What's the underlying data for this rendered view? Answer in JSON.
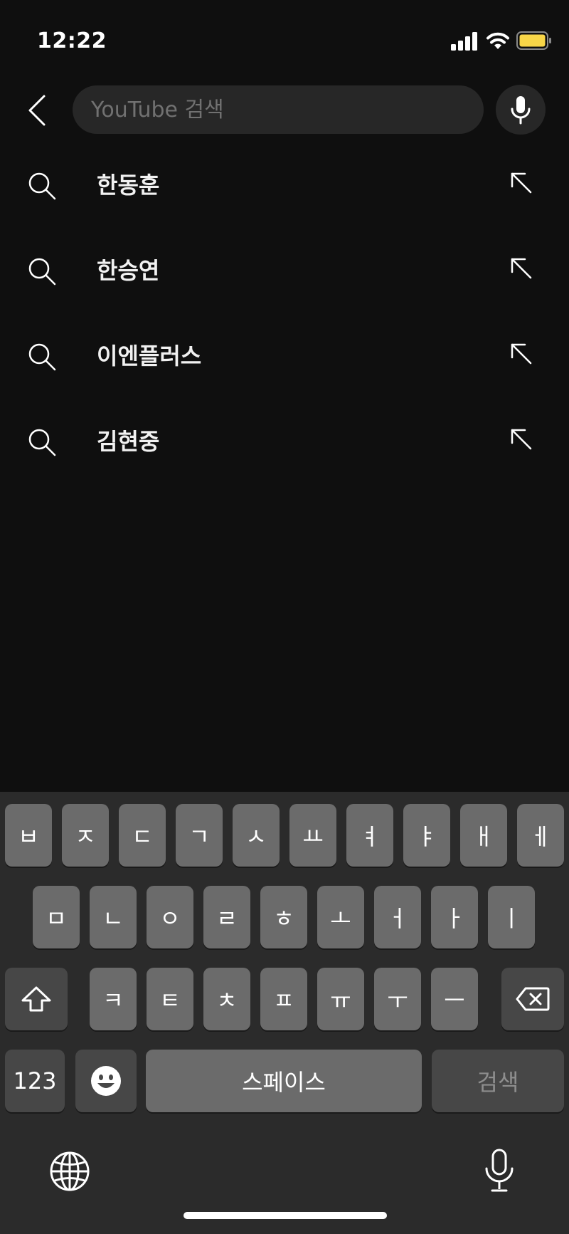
{
  "status_bar": {
    "time": "12:22",
    "battery_color": "#f8d648"
  },
  "search": {
    "placeholder": "YouTube 검색",
    "value": ""
  },
  "suggestions": [
    {
      "text": "한동훈",
      "icon": "search-icon",
      "action_icon": "arrow-up-left-icon"
    },
    {
      "text": "한승연",
      "icon": "search-icon",
      "action_icon": "arrow-up-left-icon"
    },
    {
      "text": "이엔플러스",
      "icon": "search-icon",
      "action_icon": "arrow-up-left-icon"
    },
    {
      "text": "김현중",
      "icon": "search-icon",
      "action_icon": "arrow-up-left-icon"
    }
  ],
  "keyboard": {
    "row1": [
      "ㅂ",
      "ㅈ",
      "ㄷ",
      "ㄱ",
      "ㅅ",
      "ㅛ",
      "ㅕ",
      "ㅑ",
      "ㅐ",
      "ㅔ"
    ],
    "row2": [
      "ㅁ",
      "ㄴ",
      "ㅇ",
      "ㄹ",
      "ㅎ",
      "ㅗ",
      "ㅓ",
      "ㅏ",
      "ㅣ"
    ],
    "row3": [
      "ㅋ",
      "ㅌ",
      "ㅊ",
      "ㅍ",
      "ㅠ",
      "ㅜ",
      "ㅡ"
    ],
    "numbers_label": "123",
    "space_label": "스페이스",
    "search_label": "검색",
    "shift_icon": "shift-icon",
    "backspace_icon": "backspace-icon",
    "emoji_icon": "emoji-icon",
    "globe_icon": "globe-icon",
    "dictation_icon": "microphone-icon"
  }
}
